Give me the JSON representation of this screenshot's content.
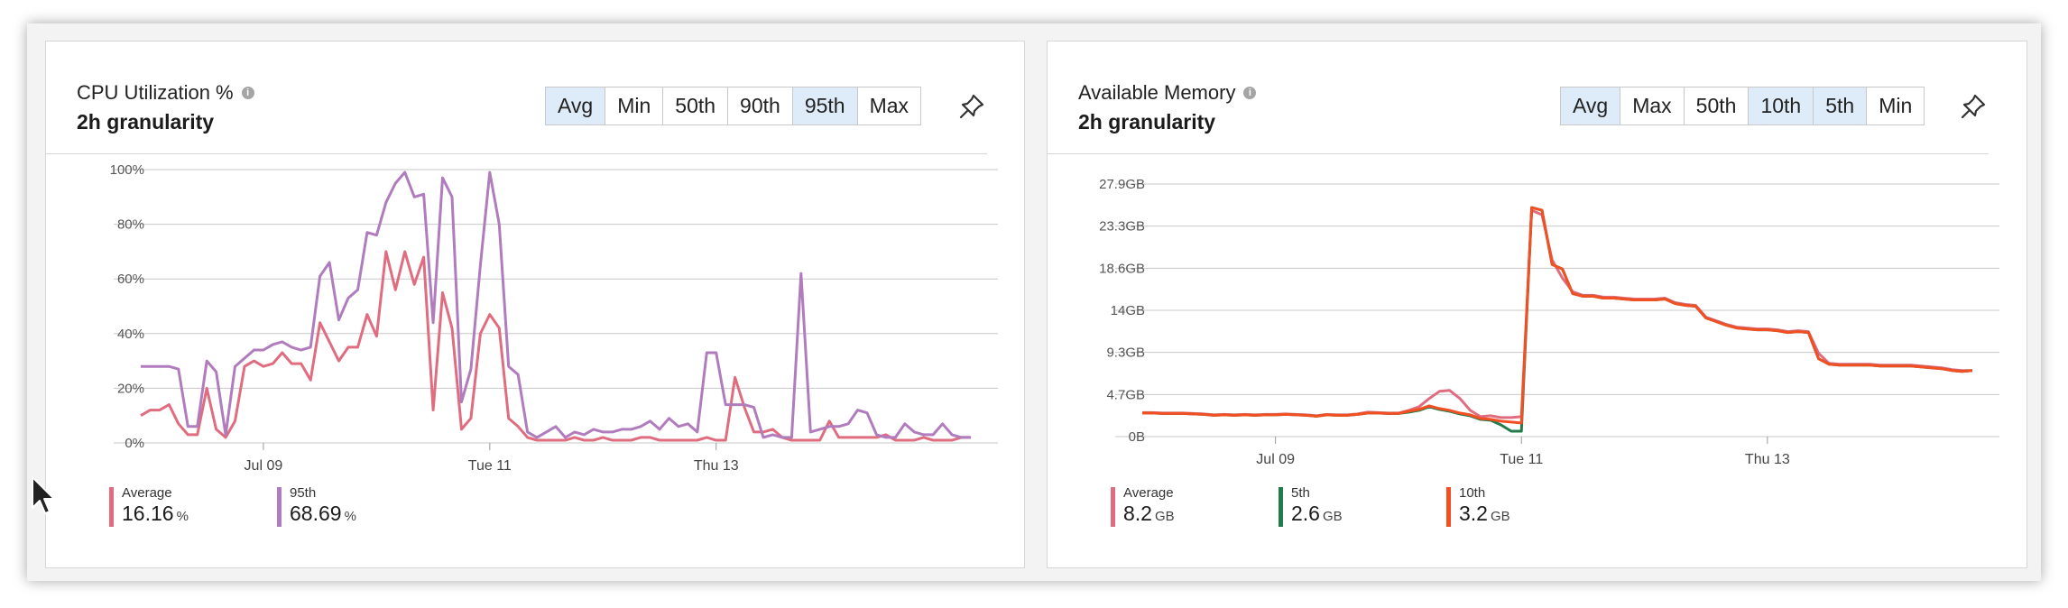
{
  "cpu": {
    "title": "CPU Utilization %",
    "granularity": "2h granularity",
    "agg_buttons": [
      {
        "label": "Avg",
        "selected": true
      },
      {
        "label": "Min",
        "selected": false
      },
      {
        "label": "50th",
        "selected": false
      },
      {
        "label": "90th",
        "selected": false
      },
      {
        "label": "95th",
        "selected": true
      },
      {
        "label": "Max",
        "selected": false
      }
    ],
    "legend": [
      {
        "name": "Average",
        "value": "16.16",
        "unit": "%",
        "color": "#e06c7f"
      },
      {
        "name": "95th",
        "value": "68.69",
        "unit": "%",
        "color": "#b07cbe"
      }
    ]
  },
  "memory": {
    "title": "Available Memory",
    "granularity": "2h granularity",
    "agg_buttons": [
      {
        "label": "Avg",
        "selected": true
      },
      {
        "label": "Max",
        "selected": false
      },
      {
        "label": "50th",
        "selected": false
      },
      {
        "label": "10th",
        "selected": true
      },
      {
        "label": "5th",
        "selected": true
      },
      {
        "label": "Min",
        "selected": false
      }
    ],
    "legend": [
      {
        "name": "Average",
        "value": "8.2",
        "unit": "GB",
        "color": "#e06c7f"
      },
      {
        "name": "5th",
        "value": "2.6",
        "unit": "GB",
        "color": "#237b4b"
      },
      {
        "name": "10th",
        "value": "3.2",
        "unit": "GB",
        "color": "#f25022"
      }
    ]
  },
  "chart_data": [
    {
      "type": "line",
      "title": "CPU Utilization %",
      "ylabels": [
        "100%",
        "80%",
        "60%",
        "40%",
        "20%",
        "0%"
      ],
      "ylim": [
        0,
        100
      ],
      "xlabels": [
        "Jul 09",
        "Tue 11",
        "Thu 13"
      ],
      "xlabel_positions": [
        13,
        37,
        61
      ],
      "grid": true,
      "series": [
        {
          "name": "Average",
          "color": "#e06c7f",
          "values": [
            10,
            12,
            12,
            14,
            7,
            3,
            3,
            20,
            5,
            2,
            8,
            28,
            30,
            28,
            29,
            33,
            29,
            29,
            23,
            44,
            37,
            30,
            35,
            35,
            47,
            39,
            70,
            56,
            70,
            58,
            68,
            12,
            55,
            42,
            5,
            9,
            40,
            47,
            42,
            9,
            6,
            2,
            1,
            1,
            1,
            1,
            2,
            1,
            1,
            2,
            1,
            1,
            1,
            2,
            2,
            1,
            1,
            1,
            1,
            1,
            2,
            1,
            1,
            24,
            13,
            4,
            4,
            5,
            2,
            1,
            1,
            1,
            1,
            8,
            2,
            2,
            2,
            2,
            2,
            3,
            1,
            1,
            1,
            2,
            1,
            1,
            1,
            2,
            2
          ]
        },
        {
          "name": "95th",
          "color": "#b07cbe",
          "values": [
            28,
            28,
            28,
            28,
            27,
            6,
            6,
            30,
            26,
            3,
            28,
            31,
            34,
            34,
            36,
            37,
            35,
            34,
            35,
            61,
            66,
            45,
            53,
            56,
            77,
            76,
            88,
            95,
            99,
            90,
            91,
            44,
            97,
            90,
            15,
            27,
            65,
            99,
            80,
            28,
            25,
            4,
            2,
            4,
            6,
            2,
            4,
            3,
            5,
            4,
            4,
            5,
            5,
            6,
            8,
            5,
            9,
            6,
            7,
            4,
            33,
            33,
            14,
            14,
            14,
            13,
            2,
            3,
            2,
            2,
            62,
            4,
            5,
            6,
            6,
            7,
            12,
            11,
            3,
            2,
            2,
            7,
            4,
            3,
            3,
            7,
            3,
            2,
            2
          ]
        }
      ]
    },
    {
      "type": "line",
      "title": "Available Memory",
      "ylabels": [
        "27.9GB",
        "23.3GB",
        "18.6GB",
        "14GB",
        "9.3GB",
        "4.7GB",
        "0B"
      ],
      "ylim": [
        0,
        27.9
      ],
      "xlabels": [
        "Jul 09",
        "Tue 11",
        "Thu 13"
      ],
      "xlabel_positions": [
        13,
        37,
        61
      ],
      "grid": true,
      "series": [
        {
          "name": "Average",
          "color": "#e06c7f",
          "values": [
            2.65,
            2.65,
            2.6,
            2.6,
            2.6,
            2.55,
            2.5,
            2.4,
            2.45,
            2.4,
            2.45,
            2.4,
            2.45,
            2.45,
            2.5,
            2.45,
            2.4,
            2.3,
            2.45,
            2.4,
            2.4,
            2.5,
            2.7,
            2.65,
            2.6,
            2.6,
            2.9,
            3.3,
            4.2,
            5.0,
            5.1,
            4.2,
            2.9,
            2.2,
            2.3,
            2.1,
            2.1,
            2.2,
            25,
            24.5,
            19.5,
            17.5,
            16,
            15.6,
            15.6,
            15.4,
            15.4,
            15.3,
            15.2,
            15.2,
            15.2,
            15.3,
            14.8,
            14.6,
            14.5,
            13.2,
            12.8,
            12.4,
            12.1,
            12.0,
            11.9,
            11.9,
            11.8,
            11.6,
            11.7,
            11.6,
            9.2,
            8.1,
            8.0,
            8.0,
            8.0,
            8.0,
            7.9,
            7.9,
            7.9,
            7.9,
            7.8,
            7.7,
            7.6,
            7.4,
            7.3,
            7.3
          ]
        },
        {
          "name": "5th",
          "color": "#237b4b",
          "values": [
            2.6,
            2.6,
            2.55,
            2.55,
            2.55,
            2.5,
            2.45,
            2.35,
            2.4,
            2.35,
            2.4,
            2.35,
            2.4,
            2.4,
            2.45,
            2.4,
            2.35,
            2.25,
            2.4,
            2.35,
            2.35,
            2.45,
            2.6,
            2.6,
            2.55,
            2.55,
            2.7,
            2.9,
            3.3,
            3.0,
            2.8,
            2.5,
            2.3,
            1.9,
            1.8,
            1.3,
            0.6,
            0.6,
            25.3,
            25.0,
            19.0,
            18.5,
            15.8,
            15.5,
            15.5,
            15.3,
            15.3,
            15.2,
            15.1,
            15.1,
            15.1,
            15.2,
            14.7,
            14.5,
            14.4,
            13.1,
            12.7,
            12.3,
            12.0,
            11.9,
            11.8,
            11.8,
            11.7,
            11.5,
            11.6,
            11.5,
            8.6,
            8.0,
            7.9,
            7.9,
            7.9,
            7.9,
            7.8,
            7.8,
            7.8,
            7.8,
            7.7,
            7.6,
            7.5,
            7.3,
            7.2,
            7.3
          ]
        },
        {
          "name": "10th",
          "color": "#f25022",
          "values": [
            2.6,
            2.6,
            2.55,
            2.55,
            2.55,
            2.5,
            2.45,
            2.35,
            2.4,
            2.35,
            2.4,
            2.35,
            2.4,
            2.4,
            2.45,
            2.4,
            2.35,
            2.25,
            2.4,
            2.35,
            2.35,
            2.45,
            2.6,
            2.6,
            2.55,
            2.55,
            2.8,
            3.0,
            3.4,
            3.1,
            2.9,
            2.6,
            2.4,
            2.0,
            1.9,
            1.7,
            1.6,
            1.5,
            25.3,
            25.0,
            19.0,
            18.5,
            15.8,
            15.5,
            15.5,
            15.3,
            15.3,
            15.2,
            15.1,
            15.1,
            15.1,
            15.2,
            14.7,
            14.5,
            14.4,
            13.1,
            12.7,
            12.3,
            12.0,
            11.9,
            11.8,
            11.8,
            11.7,
            11.5,
            11.6,
            11.5,
            8.6,
            8.0,
            7.9,
            7.9,
            7.9,
            7.9,
            7.8,
            7.8,
            7.8,
            7.8,
            7.7,
            7.6,
            7.5,
            7.3,
            7.2,
            7.3
          ]
        }
      ]
    }
  ]
}
